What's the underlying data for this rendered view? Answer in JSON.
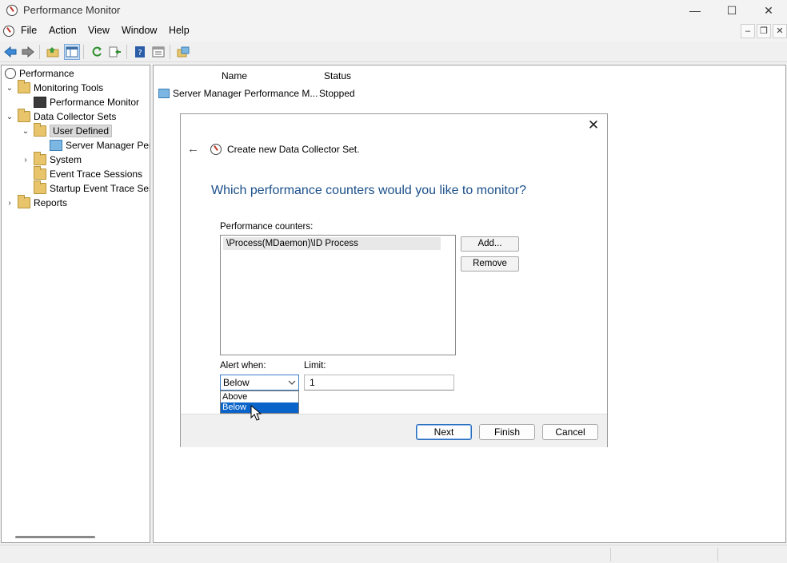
{
  "window": {
    "title": "Performance Monitor",
    "controls": {
      "minimize": "—",
      "maximize": "☐",
      "close": "✕"
    }
  },
  "menu": {
    "items": [
      "File",
      "Action",
      "View",
      "Window",
      "Help"
    ],
    "mdi_controls": [
      "–",
      "❐",
      "✕"
    ]
  },
  "toolbar": {
    "buttons": [
      "back-arrow-icon",
      "forward-arrow-icon",
      "open-folder-icon",
      "show-hide-tree-icon",
      "refresh-icon",
      "export-list-icon",
      "help-icon",
      "properties-icon",
      "new-window-icon"
    ]
  },
  "tree": {
    "items": [
      {
        "label": "Performance",
        "expand": ""
      },
      {
        "label": "Monitoring Tools",
        "expand": "⌄"
      },
      {
        "label": "Performance Monitor",
        "expand": ""
      },
      {
        "label": "Data Collector Sets",
        "expand": "⌄"
      },
      {
        "label": "User Defined",
        "expand": "⌄"
      },
      {
        "label": "Server Manager Per",
        "expand": ""
      },
      {
        "label": "System",
        "expand": "›"
      },
      {
        "label": "Event Trace Sessions",
        "expand": ""
      },
      {
        "label": "Startup Event Trace Ses",
        "expand": ""
      },
      {
        "label": "Reports",
        "expand": "›"
      }
    ]
  },
  "list": {
    "columns": [
      "Name",
      "Status"
    ],
    "rows": [
      {
        "name": "Server Manager Performance M...",
        "status": "Stopped"
      }
    ]
  },
  "dialog": {
    "close": "✕",
    "back": "←",
    "title": "Create new Data Collector Set.",
    "question": "Which performance counters would you like to monitor?",
    "counters_label": "Performance counters:",
    "counters": [
      "\\Process(MDaemon)\\ID Process"
    ],
    "add_button": "Add...",
    "remove_button": "Remove",
    "alert_label": "Alert when:",
    "alert_value": "Below",
    "alert_options": [
      "Above",
      "Below"
    ],
    "limit_label": "Limit:",
    "limit_value": "1",
    "next_button": "Next",
    "finish_button": "Finish",
    "cancel_button": "Cancel"
  },
  "colors": {
    "accent": "#0a63c9",
    "question_text": "#1b4f8a"
  }
}
